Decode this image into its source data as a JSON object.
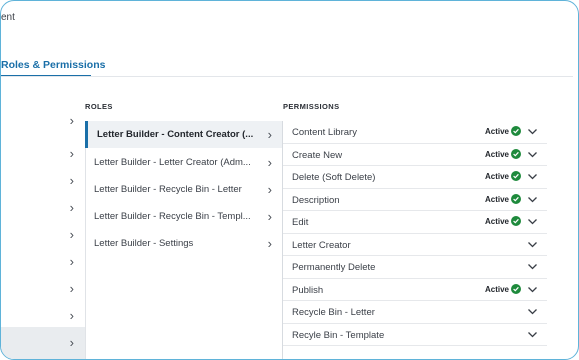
{
  "breadcrumb": "ent",
  "tabs": [
    {
      "label": "Roles & Permissions"
    }
  ],
  "columns": {
    "roles": "ROLES",
    "permissions": "PERMISSIONS"
  },
  "nav_items": 9,
  "roles": [
    {
      "label": "Letter Builder - Content Creator (..."
    },
    {
      "label": "Letter Builder - Letter Creator (Adm..."
    },
    {
      "label": "Letter Builder - Recycle Bin - Letter"
    },
    {
      "label": "Letter Builder - Recycle Bin - Templ..."
    },
    {
      "label": "Letter Builder - Settings"
    }
  ],
  "permissions": [
    {
      "label": "Content Library",
      "status": "Active"
    },
    {
      "label": "Create New",
      "status": "Active"
    },
    {
      "label": "Delete (Soft Delete)",
      "status": "Active"
    },
    {
      "label": "Description",
      "status": "Active"
    },
    {
      "label": "Edit",
      "status": "Active"
    },
    {
      "label": "Letter Creator",
      "status": ""
    },
    {
      "label": "Permanently Delete",
      "status": ""
    },
    {
      "label": "Publish",
      "status": "Active"
    },
    {
      "label": "Recycle Bin - Letter",
      "status": ""
    },
    {
      "label": "Recyle Bin - Template",
      "status": ""
    }
  ],
  "colors": {
    "accent": "#1a6fa8",
    "active": "#1e8a3c",
    "frame": "#5fb3d9"
  },
  "icons": {
    "nav": "chevron-right-icon",
    "perm": "chevron-down-icon",
    "status": "check-circle-icon"
  }
}
